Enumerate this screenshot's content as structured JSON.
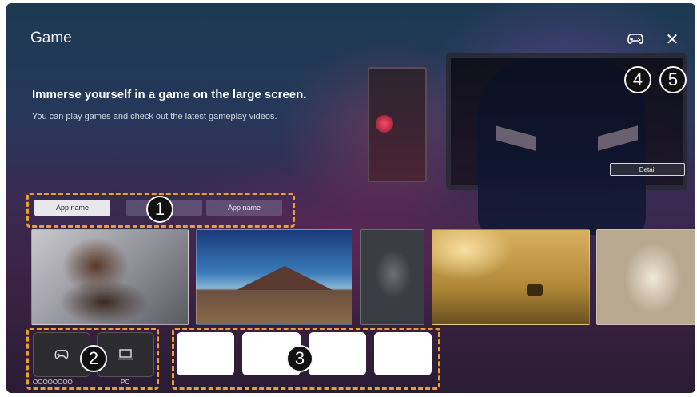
{
  "header": {
    "title": "Game",
    "gamepad_icon": "gamepad-icon",
    "close_icon": "close-icon"
  },
  "hero": {
    "headline": "Immerse yourself in a game on the large screen.",
    "subtitle": "You can play games and check out the latest gameplay videos.",
    "detail_label": "Detail"
  },
  "app_tabs": [
    {
      "label": "App name",
      "selected": true
    },
    {
      "label": "A"
    },
    {
      "label": "App name"
    }
  ],
  "thumbnails": [
    {
      "subject": "cat"
    },
    {
      "subject": "mountains"
    },
    {
      "subject": "gray cat"
    },
    {
      "subject": "deer in field"
    },
    {
      "subject": "owl"
    }
  ],
  "devices": [
    {
      "icon": "gamepad-icon",
      "label": "OOOOOOOO"
    },
    {
      "icon": "laptop-icon",
      "label": "PC"
    }
  ],
  "callouts": [
    "1",
    "2",
    "3",
    "4",
    "5"
  ],
  "colors": {
    "callout_border": "#e8a030",
    "badge_bg": "#111111",
    "text": "#ffffff"
  }
}
